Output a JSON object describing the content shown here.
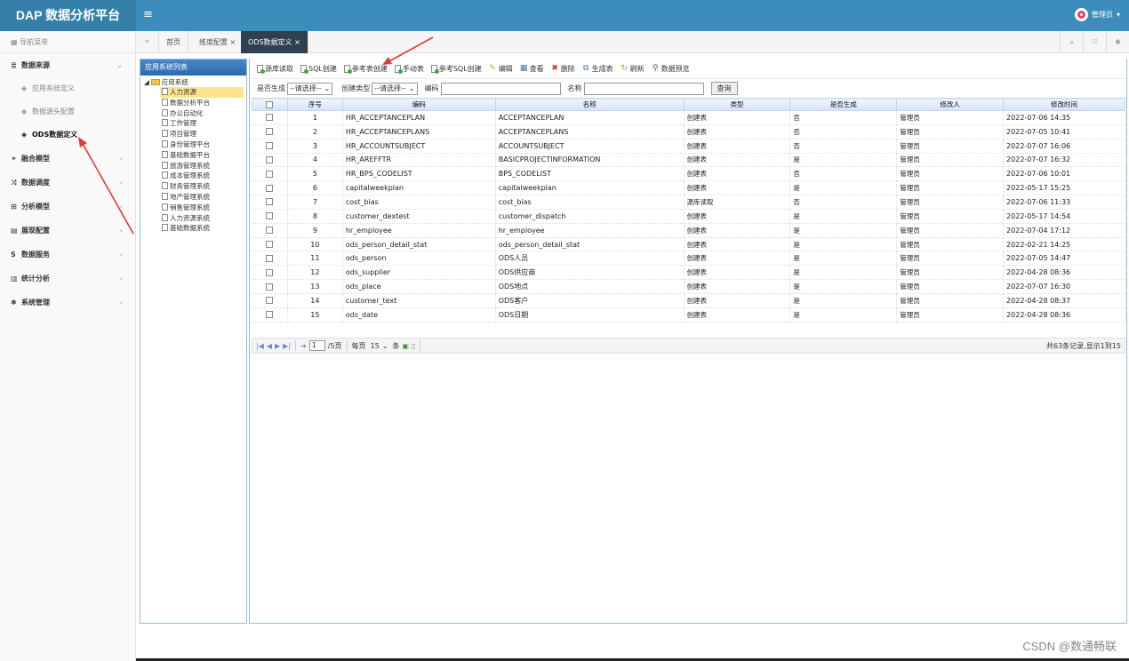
{
  "app": {
    "title": "DAP 数据分析平台",
    "menu_icon": "≡"
  },
  "user": {
    "name": "管理员",
    "caret": "▾"
  },
  "sidebar": {
    "header": "导航菜单",
    "items": [
      {
        "label": "数据来源",
        "icon": "server-icon",
        "glyph": "≣",
        "expanded": true,
        "children": [
          {
            "label": "应用系统定义",
            "active": false
          },
          {
            "label": "数据源头配置",
            "active": false
          },
          {
            "label": "ODS数据定义",
            "active": true
          }
        ]
      },
      {
        "label": "融合模型",
        "icon": "share-icon",
        "glyph": "⚭"
      },
      {
        "label": "数据调度",
        "icon": "shuffle-icon",
        "glyph": "⤨"
      },
      {
        "label": "分析模型",
        "icon": "sitemap-icon",
        "glyph": "⊞"
      },
      {
        "label": "展现配置",
        "icon": "film-icon",
        "glyph": "▤"
      },
      {
        "label": "数据服务",
        "icon": "dollar-icon",
        "glyph": "S"
      },
      {
        "label": "统计分析",
        "icon": "bar-chart-icon",
        "glyph": "▥"
      },
      {
        "label": "系统管理",
        "icon": "gear-icon",
        "glyph": "✱"
      }
    ],
    "chevron": "‹"
  },
  "tabs": {
    "items": [
      {
        "label": "首页",
        "closable": false
      },
      {
        "label": "维度配置",
        "closable": true
      },
      {
        "label": "ODS数据定义",
        "closable": true,
        "active": true
      }
    ],
    "close_glyph": "×"
  },
  "tree": {
    "title": "应用系统列表",
    "root": "应用系统",
    "nodes": [
      "人力资源",
      "数据分析平台",
      "办公自动化",
      "工作管理",
      "项目管理",
      "身份管理平台",
      "基础数据平台",
      "旅游管理系统",
      "成本管理系统",
      "财务管理系统",
      "地产管理系统",
      "销售管理系统",
      "人力资源系统",
      "基础数据系统"
    ],
    "selected_index": 0
  },
  "toolbar": [
    "源库读取",
    "SQL创建",
    "参考表创建",
    "手动表",
    "参考SQL创建",
    "编辑",
    "查看",
    "删除",
    "生成表",
    "刷新",
    "数据预览"
  ],
  "filter": {
    "is_generated_label": "是否生成",
    "is_generated_value": "--请选择--",
    "create_type_label": "创建类型",
    "create_type_value": "--请选择--",
    "code_label": "编码",
    "name_label": "名称",
    "query_button": "查询"
  },
  "table": {
    "columns": [
      "序号",
      "编码",
      "名称",
      "类型",
      "是否生成",
      "修改人",
      "修改时间"
    ],
    "rows": [
      [
        "1",
        "HR_ACCEPTANCEPLAN",
        "ACCEPTANCEPLAN",
        "创建表",
        "否",
        "管理员",
        "2022-07-06 14:35"
      ],
      [
        "2",
        "HR_ACCEPTANCEPLANS",
        "ACCEPTANCEPLANS",
        "创建表",
        "否",
        "管理员",
        "2022-07-05 10:41"
      ],
      [
        "3",
        "HR_ACCOUNTSUBJECT",
        "ACCOUNTSUBJECT",
        "创建表",
        "否",
        "管理员",
        "2022-07-07 16:06"
      ],
      [
        "4",
        "HR_AREFFTR",
        "BASICPROJECTINFORMATION",
        "创建表",
        "是",
        "管理员",
        "2022-07-07 16:32"
      ],
      [
        "5",
        "HR_BPS_CODELIST",
        "BPS_CODELIST",
        "创建表",
        "否",
        "管理员",
        "2022-07-06 10:01"
      ],
      [
        "6",
        "capitalweekplan",
        "capitalweekplan",
        "创建表",
        "是",
        "管理员",
        "2022-05-17 15:25"
      ],
      [
        "7",
        "cost_bias",
        "cost_bias",
        "源库读取",
        "否",
        "管理员",
        "2022-07-06 11:33"
      ],
      [
        "8",
        "customer_dextest",
        "customer_dispatch",
        "创建表",
        "是",
        "管理员",
        "2022-05-17 14:54"
      ],
      [
        "9",
        "hr_employee",
        "hr_employee",
        "创建表",
        "是",
        "管理员",
        "2022-07-04 17:12"
      ],
      [
        "10",
        "ods_person_detail_stat",
        "ods_person_detail_stat",
        "创建表",
        "是",
        "管理员",
        "2022-02-21 14:25"
      ],
      [
        "11",
        "ods_person",
        "ODS人员",
        "创建表",
        "是",
        "管理员",
        "2022-07-05 14:47"
      ],
      [
        "12",
        "ods_supplier",
        "ODS供应商",
        "创建表",
        "是",
        "管理员",
        "2022-04-28 08:36"
      ],
      [
        "13",
        "ods_place",
        "ODS地点",
        "创建表",
        "是",
        "管理员",
        "2022-07-07 16:30"
      ],
      [
        "14",
        "customer_text",
        "ODS客户",
        "创建表",
        "是",
        "管理员",
        "2022-04-28 08:37"
      ],
      [
        "15",
        "ods_date",
        "ODS日期",
        "创建表",
        "是",
        "管理员",
        "2022-04-28 08:36"
      ]
    ]
  },
  "pager": {
    "current_page": "1",
    "total_pages": "/5页",
    "per_page_label": "每页",
    "per_page_value": "15",
    "per_page_unit": "条",
    "summary": "共63条记录,显示1到15"
  },
  "watermark": "CSDN @数通畅联",
  "colors": {
    "header": "#3c8dbc",
    "brand": "#367fa9",
    "active_tab": "#2f4050",
    "arrow": "#e53935"
  }
}
